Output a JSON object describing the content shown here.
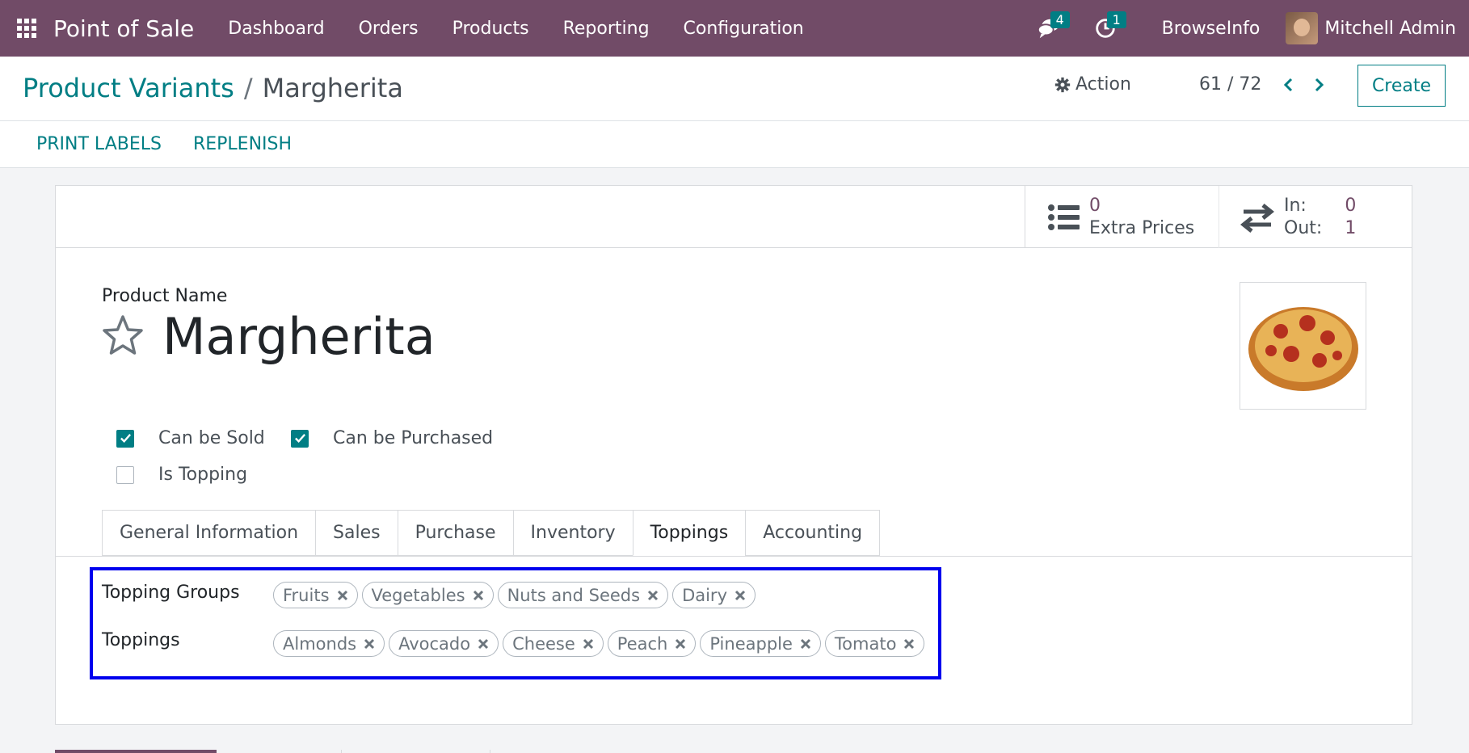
{
  "navbar": {
    "app_name": "Point of Sale",
    "menu": [
      "Dashboard",
      "Orders",
      "Products",
      "Reporting",
      "Configuration"
    ],
    "messages_count": "4",
    "activities_count": "1",
    "company": "BrowseInfo",
    "user": "Mitchell Admin"
  },
  "control_panel": {
    "breadcrumb_parent": "Product Variants",
    "breadcrumb_sep": "/",
    "breadcrumb_current": "Margherita",
    "action_label": "Action",
    "pager": "61 / 72",
    "create_label": "Create"
  },
  "statusbar": {
    "print_labels": "PRINT LABELS",
    "replenish": "REPLENISH"
  },
  "smart_buttons": {
    "extra_prices_value": "0",
    "extra_prices_label": "Extra Prices",
    "in_label": "In:",
    "in_value": "0",
    "out_label": "Out:",
    "out_value": "1"
  },
  "product": {
    "name_label": "Product Name",
    "name": "Margherita",
    "can_be_sold": "Can be Sold",
    "can_be_purchased": "Can be Purchased",
    "is_topping": "Is Topping"
  },
  "tabs": [
    "General Information",
    "Sales",
    "Purchase",
    "Inventory",
    "Toppings",
    "Accounting"
  ],
  "toppings_tab": {
    "groups_label": "Topping Groups",
    "groups": [
      "Fruits",
      "Vegetables",
      "Nuts and Seeds",
      "Dairy"
    ],
    "toppings_label": "Toppings",
    "toppings": [
      "Almonds",
      "Avocado",
      "Cheese",
      "Peach",
      "Pineapple",
      "Tomato"
    ]
  },
  "colors": {
    "navbar": "#714b67",
    "accent": "#017e84",
    "highlight_border": "#0000ee"
  }
}
